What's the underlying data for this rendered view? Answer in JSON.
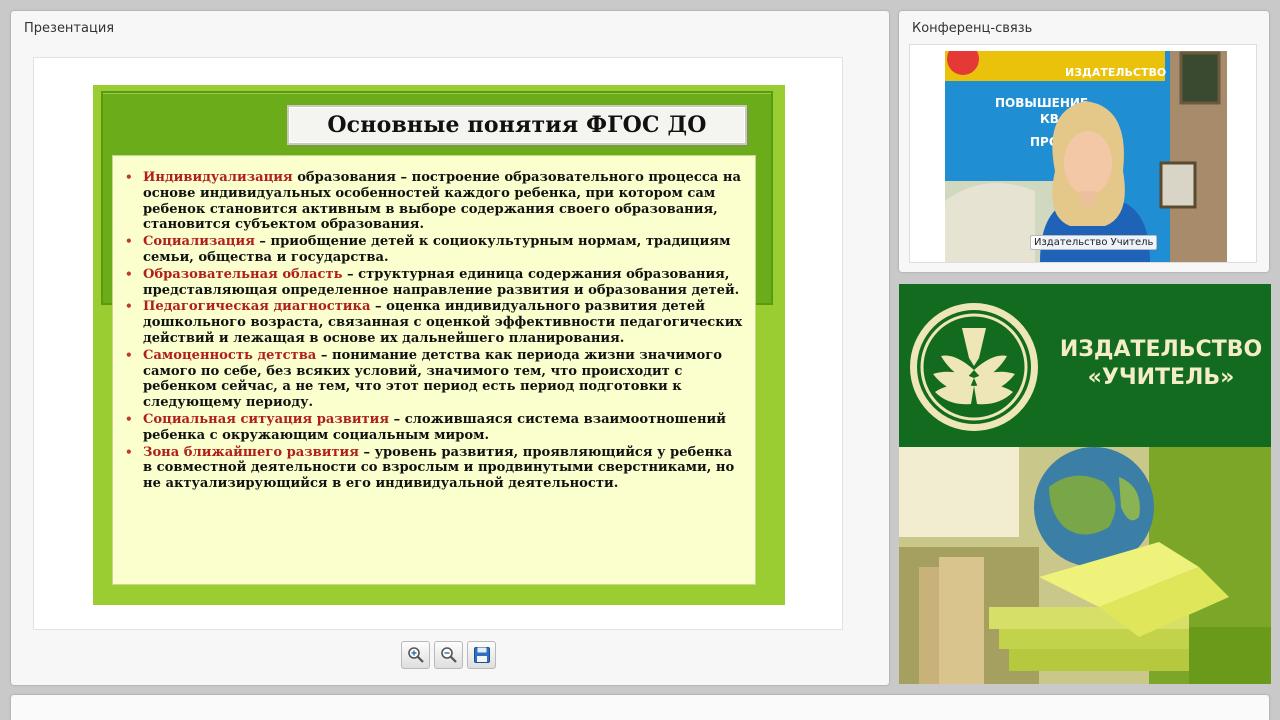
{
  "presentation_panel": {
    "title": "Презентация"
  },
  "slide": {
    "title": "Основные понятия ФГОС ДО",
    "items": [
      {
        "term": "Индивидуализация",
        "text": " образования – построение образовательного процесса на основе индивидуальных особенностей каждого ребенка, при котором сам ребенок становится активным в выборе содержания своего образования, становится субъектом образования."
      },
      {
        "term": "Социализация",
        "text": " – приобщение детей к социокультурным нормам, традициям семьи, общества и государства."
      },
      {
        "term": "Образовательная область",
        "text": " – структурная единица содержания образования, представляющая определенное направление развития и образования детей."
      },
      {
        "term": "Педагогическая диагностика",
        "text": " – оценка индивидуального развития детей дошкольного возраста, связанная с оценкой эффективности педагогических действий и лежащая в основе их дальнейшего планирования."
      },
      {
        "term": "Самоценность детства",
        "text": " – понимание детства как периода жизни значимого самого по себе, без всяких условий, значимого тем, что происходит с ребенком сейчас, а не тем, что этот период есть период подготовки к следующему периоду."
      },
      {
        "term": "Социальная ситуация развития",
        "text": " – сложившаяся система взаимоотношений ребенка с окружающим социальным миром."
      },
      {
        "term": "Зона ближайшего развития",
        "text": " – уровень развития, проявляющийся у ребенка в совместной деятельности со взрослым и продвинутыми сверстниками, но не актуализирующийся в его индивидуальной деятельности."
      }
    ]
  },
  "toolbar": {
    "zoom_in_icon": "zoom-in-icon",
    "zoom_out_icon": "zoom-out-icon",
    "save_icon": "floppy-disk-icon"
  },
  "conference_panel": {
    "title": "Конференц-связь",
    "camera_label": "Издательство Учитель",
    "backdrop_lines": [
      "ИЗДАТЕЛЬСТВО",
      "ПОВЫШЕНИЕ",
      "КВАЛИ",
      "ПРОФ"
    ]
  },
  "banner": {
    "line1": "ИЗДАТЕЛЬСТВО",
    "line2": "«УЧИТЕЛЬ»",
    "brand_color": "#126b1f",
    "text_color": "#f5ecc8"
  }
}
